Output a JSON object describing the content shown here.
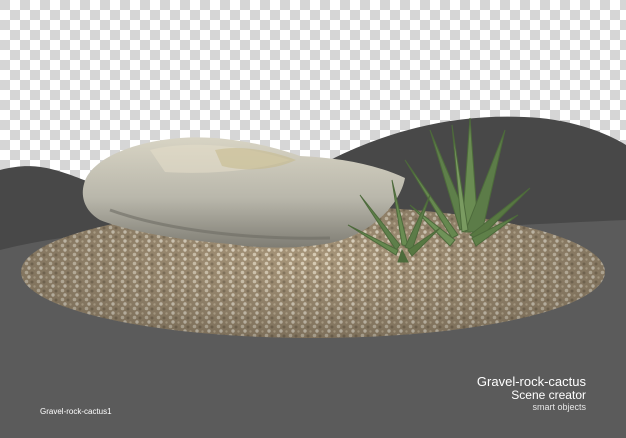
{
  "image": {
    "title": "Gravel-rock-cactus",
    "subtitle": "Scene creator",
    "note": "smart objects",
    "file_label": "Gravel-rock-cactus1"
  },
  "colors": {
    "checker_light": "#ffffff",
    "checker_dark": "#d6d6d6",
    "ground_dark": "#4a4a4a",
    "ground_mid": "#5c5c5c",
    "gravel": "#b3a48a",
    "rock": "#c9c6b6",
    "cactus": "#5f7f4a"
  }
}
